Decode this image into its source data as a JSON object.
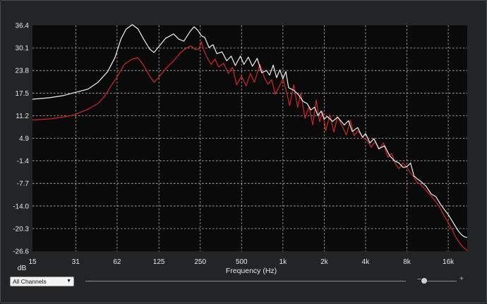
{
  "chart_data": {
    "type": "line",
    "xlabel": "Frequency (Hz)",
    "ylabel": "dB",
    "x_scale": "log",
    "xlim": [
      15,
      22000
    ],
    "ylim": [
      -26.6,
      36.4
    ],
    "x_ticks": [
      15,
      31,
      62,
      125,
      250,
      500,
      1000,
      2000,
      4000,
      8000,
      16000
    ],
    "x_tick_labels": [
      "15",
      "31",
      "62",
      "125",
      "250",
      "500",
      "1k",
      "2k",
      "4k",
      "8k",
      "16k"
    ],
    "y_ticks": [
      36.4,
      30.1,
      23.8,
      17.5,
      11.2,
      4.9,
      -1.4,
      -7.7,
      -14.0,
      -20.3,
      -26.6
    ],
    "y_tick_labels": [
      "36.4",
      "30.1",
      "23.8",
      "17.5",
      "11.2",
      "4.9",
      "-1.4",
      "-7.7",
      "-14.0",
      "-20.3",
      "-26.6"
    ],
    "grid": true,
    "series": [
      {
        "color": "#f2f2f2",
        "points": [
          [
            15,
            15.8
          ],
          [
            20,
            16.2
          ],
          [
            25,
            16.8
          ],
          [
            30,
            17.6
          ],
          [
            38,
            18.6
          ],
          [
            45,
            20.5
          ],
          [
            53,
            23.5
          ],
          [
            60,
            27.5
          ],
          [
            66,
            32.5
          ],
          [
            72,
            35.3
          ],
          [
            80,
            36.6
          ],
          [
            88,
            35.4
          ],
          [
            97,
            32.5
          ],
          [
            107,
            29.8
          ],
          [
            115,
            28.8
          ],
          [
            125,
            30.5
          ],
          [
            140,
            32.8
          ],
          [
            160,
            34.0
          ],
          [
            175,
            32.5
          ],
          [
            190,
            32.0
          ],
          [
            210,
            34.6
          ],
          [
            225,
            36.0
          ],
          [
            240,
            35.0
          ],
          [
            255,
            33.5
          ],
          [
            270,
            33.0
          ],
          [
            290,
            30.2
          ],
          [
            310,
            31.0
          ],
          [
            330,
            28.5
          ],
          [
            360,
            29.0
          ],
          [
            390,
            26.5
          ],
          [
            420,
            27.8
          ],
          [
            450,
            25.2
          ],
          [
            490,
            27.8
          ],
          [
            520,
            25.5
          ],
          [
            560,
            27.5
          ],
          [
            600,
            25.0
          ],
          [
            650,
            27.2
          ],
          [
            700,
            23.2
          ],
          [
            760,
            23.8
          ],
          [
            800,
            22.5
          ],
          [
            850,
            25.3
          ],
          [
            900,
            21.8
          ],
          [
            950,
            24.0
          ],
          [
            1000,
            21.5
          ],
          [
            1050,
            23.5
          ],
          [
            1100,
            19.0
          ],
          [
            1200,
            18.3
          ],
          [
            1300,
            17.0
          ],
          [
            1400,
            15.2
          ],
          [
            1500,
            14.6
          ],
          [
            1600,
            12.8
          ],
          [
            1700,
            13.6
          ],
          [
            1800,
            11.2
          ],
          [
            1900,
            12.5
          ],
          [
            2000,
            10.2
          ],
          [
            2100,
            11.0
          ],
          [
            2300,
            9.6
          ],
          [
            2500,
            10.8
          ],
          [
            2800,
            8.6
          ],
          [
            3000,
            9.8
          ],
          [
            3200,
            6.8
          ],
          [
            3500,
            7.9
          ],
          [
            3800,
            5.2
          ],
          [
            4000,
            6.2
          ],
          [
            4300,
            3.6
          ],
          [
            4600,
            4.8
          ],
          [
            5000,
            2.0
          ],
          [
            5500,
            2.8
          ],
          [
            6000,
            0.0
          ],
          [
            6500,
            -1.4
          ],
          [
            7000,
            -2.0
          ],
          [
            7500,
            -3.2
          ],
          [
            8000,
            -3.0
          ],
          [
            8500,
            -2.0
          ],
          [
            9000,
            -5.6
          ],
          [
            9500,
            -6.4
          ],
          [
            10000,
            -7.0
          ],
          [
            11000,
            -8.4
          ],
          [
            12000,
            -10.6
          ],
          [
            13000,
            -11.4
          ],
          [
            14000,
            -13.4
          ],
          [
            15000,
            -15.0
          ],
          [
            16000,
            -16.4
          ],
          [
            17000,
            -18.0
          ],
          [
            18000,
            -19.6
          ],
          [
            19000,
            -21.0
          ],
          [
            20000,
            -22.0
          ],
          [
            21000,
            -22.6
          ],
          [
            22000,
            -22.8
          ]
        ]
      },
      {
        "color": "#d42424",
        "points": [
          [
            15,
            10.0
          ],
          [
            20,
            10.3
          ],
          [
            25,
            10.8
          ],
          [
            30,
            11.4
          ],
          [
            38,
            13.0
          ],
          [
            45,
            14.6
          ],
          [
            50,
            16.5
          ],
          [
            56,
            19.5
          ],
          [
            62,
            22.0
          ],
          [
            70,
            25.5
          ],
          [
            80,
            27.0
          ],
          [
            88,
            27.3
          ],
          [
            96,
            25.5
          ],
          [
            105,
            22.8
          ],
          [
            115,
            20.5
          ],
          [
            125,
            22.0
          ],
          [
            140,
            24.3
          ],
          [
            160,
            26.5
          ],
          [
            180,
            28.8
          ],
          [
            200,
            30.2
          ],
          [
            215,
            30.6
          ],
          [
            230,
            29.6
          ],
          [
            245,
            29.8
          ],
          [
            255,
            31.8
          ],
          [
            265,
            29.5
          ],
          [
            280,
            27.5
          ],
          [
            300,
            25.5
          ],
          [
            320,
            27.0
          ],
          [
            340,
            24.8
          ],
          [
            370,
            25.8
          ],
          [
            400,
            23.0
          ],
          [
            430,
            24.7
          ],
          [
            460,
            19.8
          ],
          [
            500,
            22.2
          ],
          [
            540,
            19.5
          ],
          [
            580,
            23.0
          ],
          [
            620,
            20.5
          ],
          [
            680,
            25.5
          ],
          [
            730,
            22.0
          ],
          [
            780,
            20.0
          ],
          [
            830,
            21.2
          ],
          [
            880,
            17.2
          ],
          [
            940,
            19.3
          ],
          [
            1000,
            21.5
          ],
          [
            1060,
            18.0
          ],
          [
            1120,
            14.0
          ],
          [
            1200,
            19.8
          ],
          [
            1280,
            13.5
          ],
          [
            1350,
            17.5
          ],
          [
            1450,
            10.5
          ],
          [
            1550,
            13.8
          ],
          [
            1650,
            8.6
          ],
          [
            1750,
            15.6
          ],
          [
            1850,
            9.5
          ],
          [
            1950,
            12.4
          ],
          [
            2050,
            7.0
          ],
          [
            2200,
            11.5
          ],
          [
            2350,
            6.6
          ],
          [
            2500,
            11.0
          ],
          [
            2700,
            8.3
          ],
          [
            2900,
            5.8
          ],
          [
            3100,
            10.0
          ],
          [
            3300,
            5.6
          ],
          [
            3500,
            7.0
          ],
          [
            3800,
            5.3
          ],
          [
            4100,
            4.3
          ],
          [
            4400,
            2.4
          ],
          [
            4700,
            4.0
          ],
          [
            5000,
            1.8
          ],
          [
            5400,
            3.6
          ],
          [
            5800,
            -0.4
          ],
          [
            6200,
            0.7
          ],
          [
            6600,
            -2.2
          ],
          [
            7000,
            -3.6
          ],
          [
            7500,
            -2.0
          ],
          [
            8000,
            -3.2
          ],
          [
            8500,
            -4.8
          ],
          [
            9000,
            -6.0
          ],
          [
            9500,
            -7.4
          ],
          [
            10000,
            -7.8
          ],
          [
            11000,
            -9.6
          ],
          [
            12000,
            -11.2
          ],
          [
            13000,
            -12.8
          ],
          [
            14000,
            -14.6
          ],
          [
            15000,
            -16.8
          ],
          [
            16000,
            -18.6
          ],
          [
            17000,
            -20.4
          ],
          [
            18000,
            -22.4
          ],
          [
            19000,
            -23.8
          ],
          [
            20000,
            -25.0
          ],
          [
            21000,
            -25.8
          ],
          [
            22000,
            -26.4
          ]
        ]
      }
    ]
  },
  "controls": {
    "channel_selector": "All Channels",
    "zoom_minus": "−",
    "zoom_plus": "+"
  }
}
